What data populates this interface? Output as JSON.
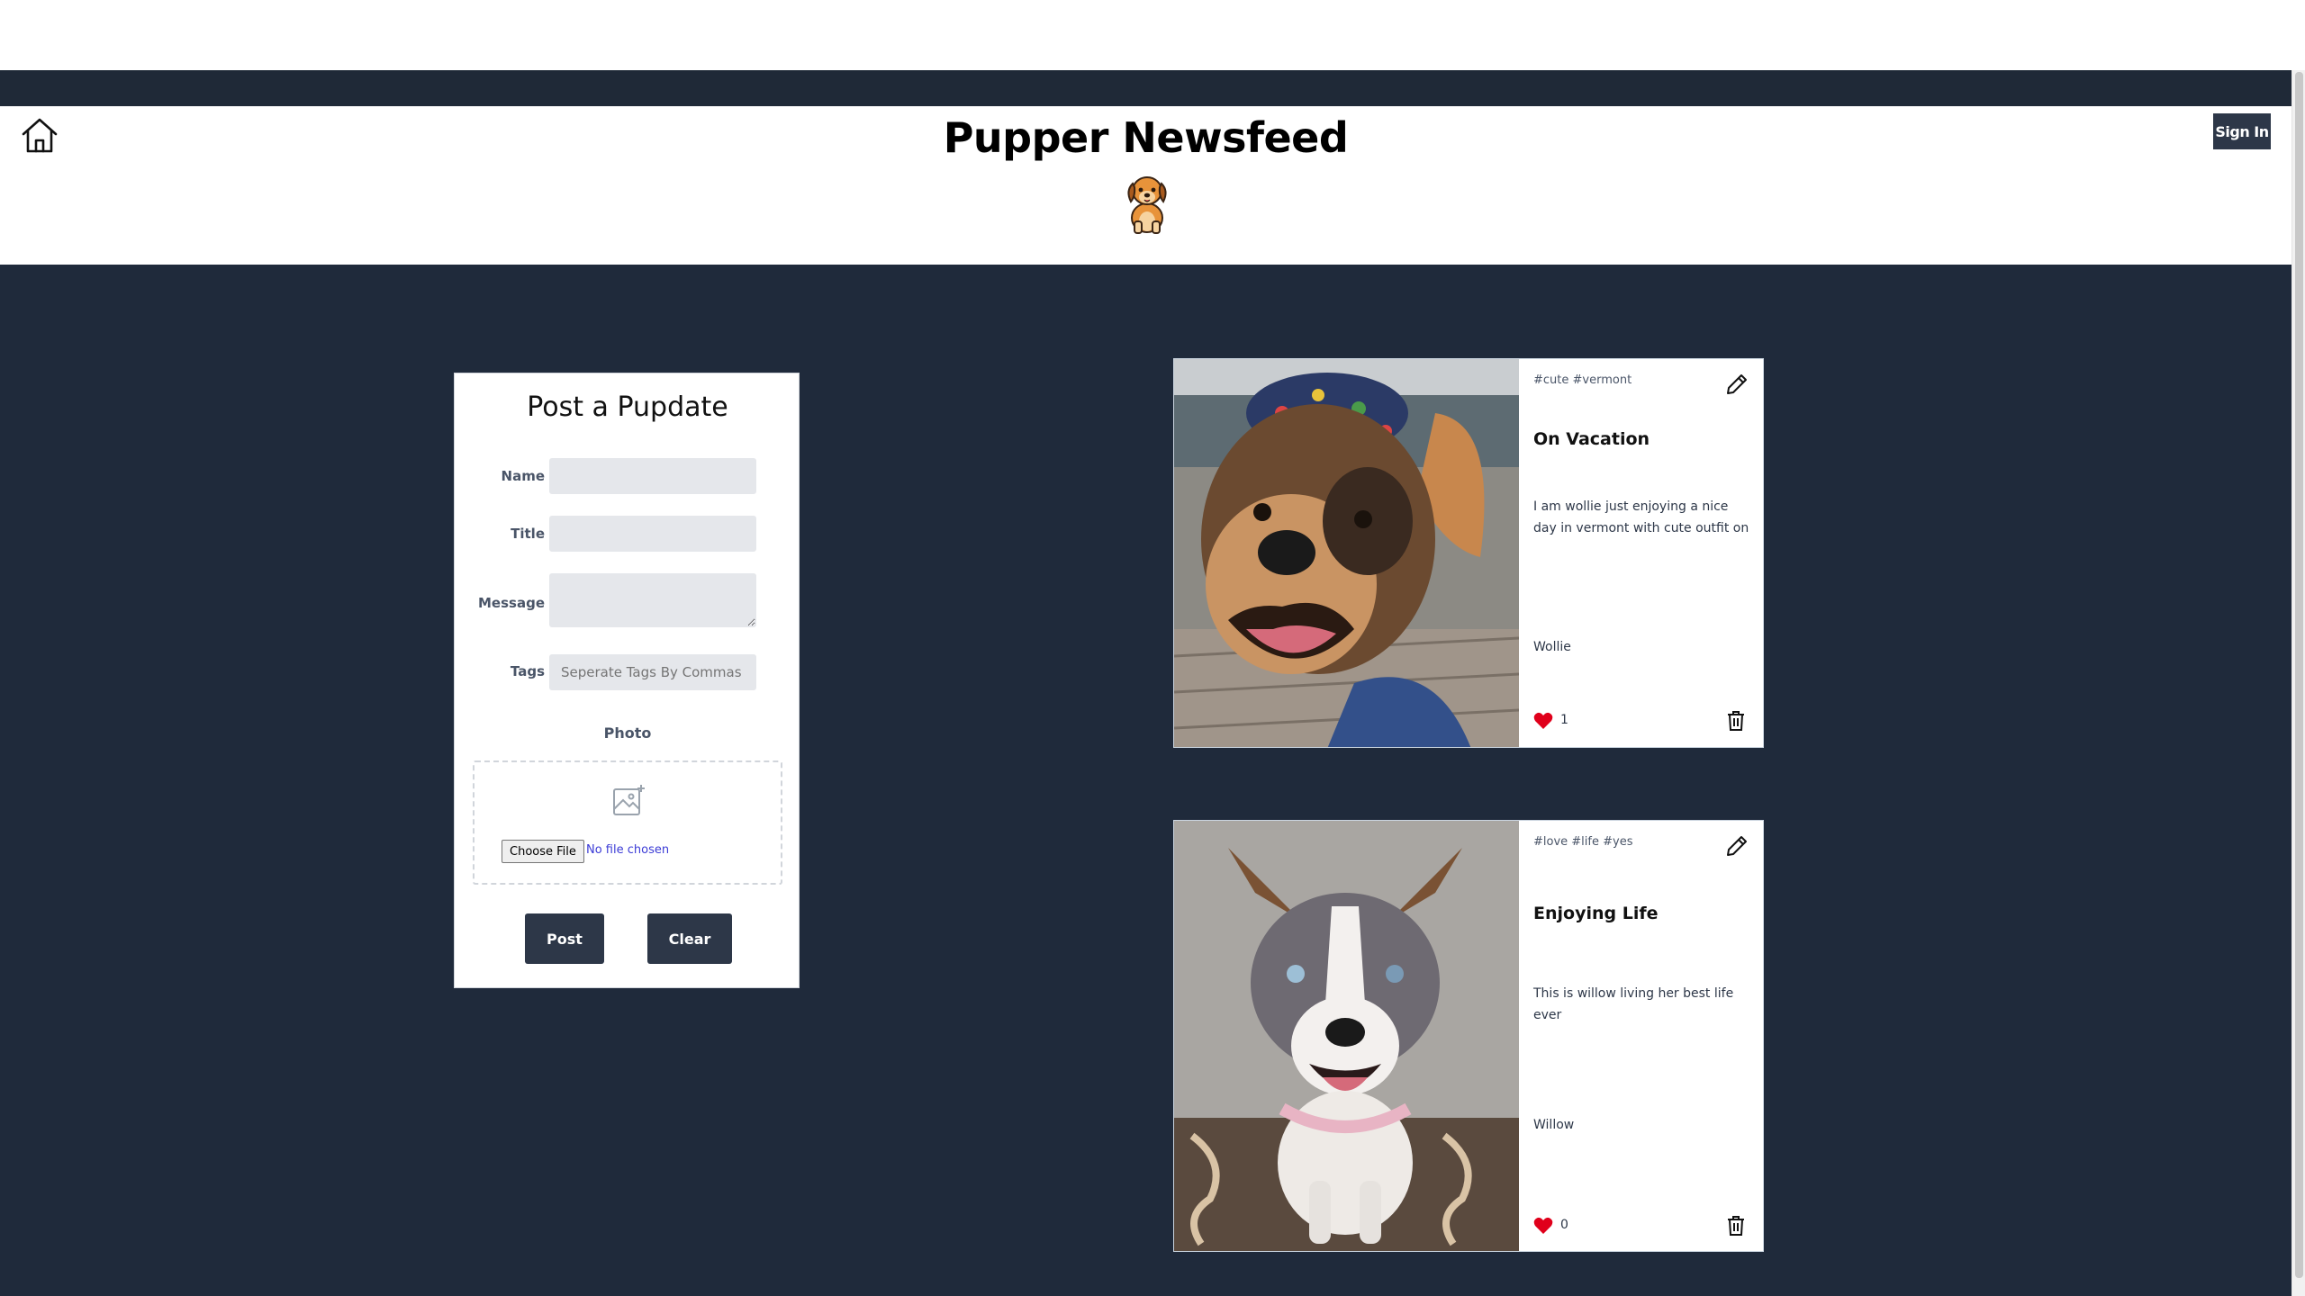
{
  "header": {
    "title": "Pupper Newsfeed",
    "signin_label": "Sign In"
  },
  "form": {
    "title": "Post a Pupdate",
    "name_label": "Name",
    "title_label": "Title",
    "message_label": "Message",
    "tags_label": "Tags",
    "tags_placeholder": "Seperate Tags By Commas",
    "photo_label": "Photo",
    "choose_file_label": "Choose File",
    "no_file_text": "No file chosen",
    "post_label": "Post",
    "clear_label": "Clear"
  },
  "posts": [
    {
      "tags": "#cute #vermont",
      "title": "On Vacation",
      "message": "I am wollie just enjoying a nice day in vermont with cute outfit on",
      "author": "Wollie",
      "likes": "1"
    },
    {
      "tags": "#love #life #yes",
      "title": "Enjoying Life",
      "message": "This is willow living her best life ever",
      "author": "Willow",
      "likes": "0"
    }
  ],
  "icons": {
    "home": "home-icon",
    "logo": "dog-logo",
    "image_add": "image-add-icon",
    "edit": "pencil-icon",
    "like": "heart-icon",
    "delete": "trash-icon"
  },
  "colors": {
    "navy": "#1f2a3b",
    "button": "#2d3748",
    "heart": "#e0001b"
  }
}
